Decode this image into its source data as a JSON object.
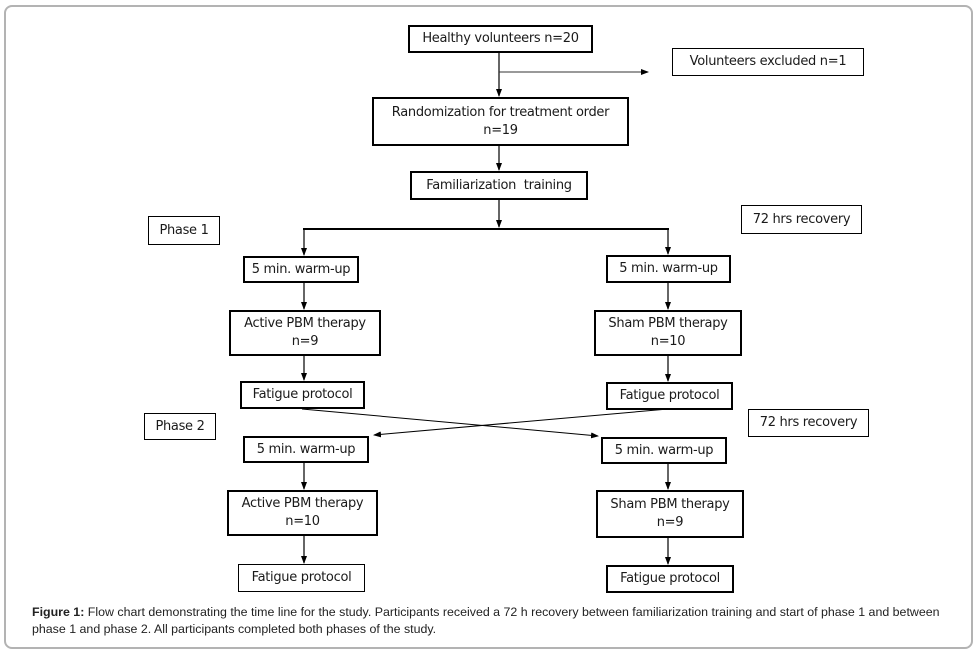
{
  "figure": {
    "nodes": {
      "healthy": {
        "lines": [
          "Healthy volunteers n=20"
        ]
      },
      "excluded": {
        "lines": [
          "Volunteers excluded n=1"
        ]
      },
      "randomization": {
        "lines": [
          "Randomization for treatment order",
          "n=19"
        ]
      },
      "familiarization": {
        "lines": [
          "Familiarization  training"
        ]
      },
      "phase1_label": {
        "lines": [
          "Phase 1"
        ]
      },
      "recovery1": {
        "lines": [
          "72 hrs recovery"
        ]
      },
      "p1_left_warmup": {
        "lines": [
          "5 min. warm-up"
        ]
      },
      "p1_right_warmup": {
        "lines": [
          "5 min. warm-up"
        ]
      },
      "p1_active": {
        "lines": [
          "Active PBM therapy",
          "n=9"
        ]
      },
      "p1_sham": {
        "lines": [
          "Sham PBM therapy",
          "n=10"
        ]
      },
      "p1_left_fatigue": {
        "lines": [
          "Fatigue protocol"
        ]
      },
      "p1_right_fatigue": {
        "lines": [
          "Fatigue protocol"
        ]
      },
      "phase2_label": {
        "lines": [
          "Phase 2"
        ]
      },
      "recovery2": {
        "lines": [
          "72 hrs recovery"
        ]
      },
      "p2_left_warmup": {
        "lines": [
          "5 min. warm-up"
        ]
      },
      "p2_right_warmup": {
        "lines": [
          "5 min. warm-up"
        ]
      },
      "p2_active": {
        "lines": [
          "Active PBM therapy",
          "n=10"
        ]
      },
      "p2_sham": {
        "lines": [
          "Sham PBM therapy",
          "n=9"
        ]
      },
      "p2_left_fatigue": {
        "lines": [
          "Fatigue protocol"
        ]
      },
      "p2_right_fatigue": {
        "lines": [
          "Fatigue protocol"
        ]
      }
    },
    "edges": [
      {
        "from": "healthy",
        "to": "randomization"
      },
      {
        "from": "healthy",
        "to": "excluded"
      },
      {
        "from": "randomization",
        "to": "familiarization"
      },
      {
        "from": "familiarization",
        "to": "p1_left_warmup"
      },
      {
        "from": "familiarization",
        "to": "p1_right_warmup"
      },
      {
        "from": "p1_left_warmup",
        "to": "p1_active"
      },
      {
        "from": "p1_right_warmup",
        "to": "p1_sham"
      },
      {
        "from": "p1_active",
        "to": "p1_left_fatigue"
      },
      {
        "from": "p1_sham",
        "to": "p1_right_fatigue"
      },
      {
        "from": "p1_left_fatigue",
        "to": "p2_right_warmup"
      },
      {
        "from": "p1_right_fatigue",
        "to": "p2_left_warmup"
      },
      {
        "from": "p2_left_warmup",
        "to": "p2_active"
      },
      {
        "from": "p2_right_warmup",
        "to": "p2_sham"
      },
      {
        "from": "p2_active",
        "to": "p2_left_fatigue"
      },
      {
        "from": "p2_sham",
        "to": "p2_right_fatigue"
      }
    ],
    "caption": {
      "label": "Figure 1:",
      "text": " Flow chart demonstrating the time line for the study. Participants received a 72 h recovery between familiarization training and start of phase 1 and between phase 1 and phase 2. All participants completed both phases of the study."
    }
  }
}
